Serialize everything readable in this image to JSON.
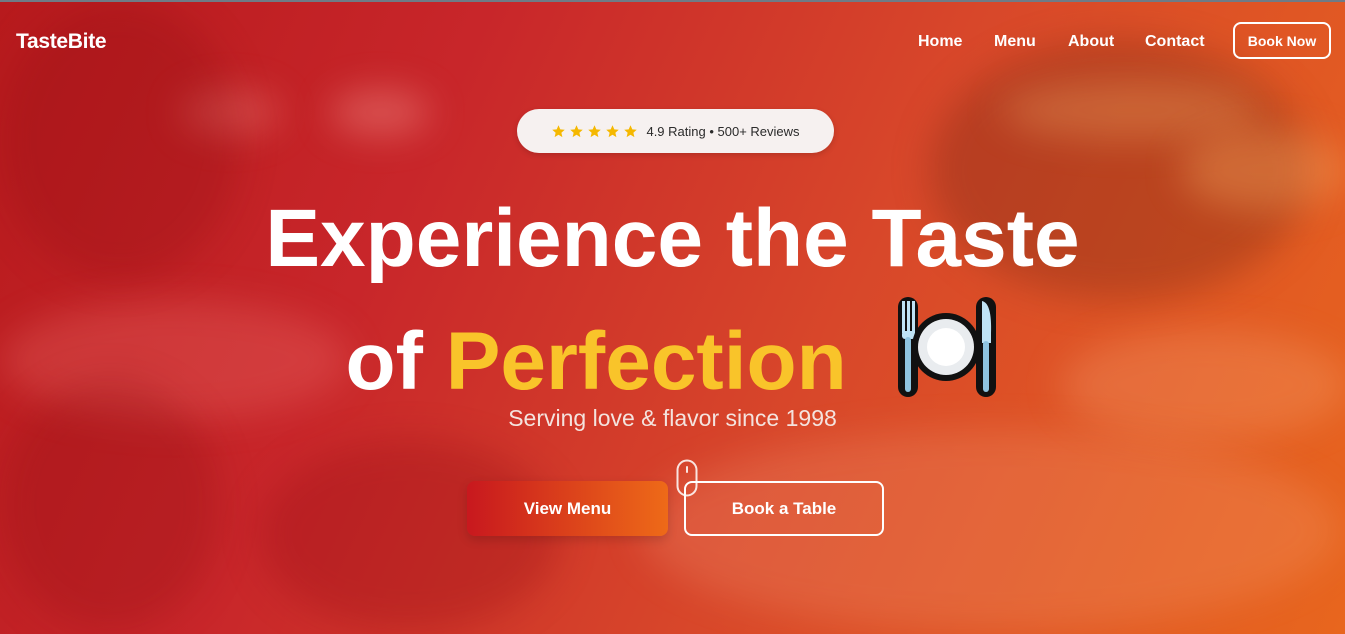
{
  "nav": {
    "brand": "TasteBite",
    "links": [
      "Home",
      "Menu",
      "About",
      "Contact"
    ],
    "cta": "Book Now"
  },
  "rating": {
    "stars": 5,
    "text": "4.9 Rating • 500+ Reviews",
    "star_color": "#f5b800"
  },
  "hero": {
    "line1": "Experience the Taste",
    "line2_prefix": "of",
    "line2_accent": "Perfection",
    "icon": "fork-plate-knife-icon",
    "subtitle": "Serving love & flavor since 1998",
    "accent_color": "#f9c42a"
  },
  "actions": {
    "primary": "View Menu",
    "secondary": "Book a Table"
  }
}
